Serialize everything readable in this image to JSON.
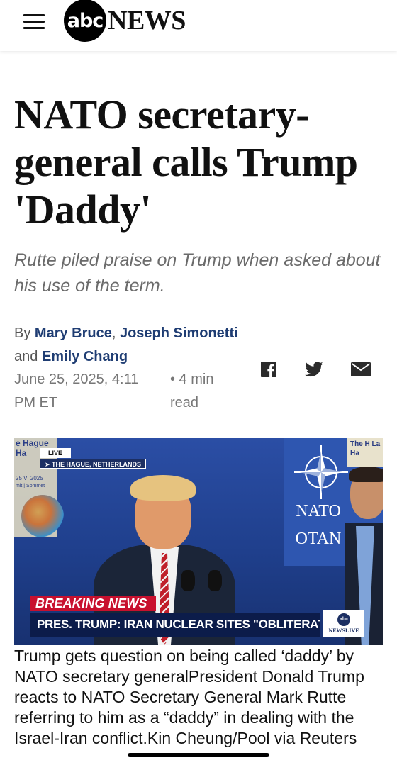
{
  "header": {
    "logo_abc": "abc",
    "logo_news": "NEWS"
  },
  "article": {
    "headline": "NATO secretary-general calls Trump 'Daddy'",
    "subhead": "Rutte piled praise on Trump when asked about his use of the term.",
    "byline": {
      "prefix": "By",
      "authors": [
        "Mary Bruce",
        "Joseph Simonetti",
        "Emily Chang"
      ],
      "sep1": ",",
      "and": "and"
    },
    "date": "June 25, 2025, 4:11 PM ET",
    "read_time": "• 4 min read"
  },
  "share": {
    "icons": [
      "facebook-icon",
      "twitter-icon",
      "email-icon"
    ]
  },
  "video": {
    "live_label": "LIVE",
    "location": "➤ THE HAGUE, NETHERLANDS",
    "bg_left_title": "e Hague Ha",
    "bg_left_date": "25 VI 2025",
    "bg_left_sub": "mit | Sommet",
    "bg_right_top": "The H La Ha",
    "nato_en": "NATO",
    "nato_fr": "OTAN",
    "breaking": "BREAKING NEWS",
    "ticker": "PRES. TRUMP: IRAN NUCLEAR SITES \"OBLITERATED\"",
    "ticker_logo_abc": "abc",
    "ticker_logo_text": "NEWSLIVE"
  },
  "caption": "Trump gets question on being called ‘daddy’ by NATO secretary generalPresident Donald Trump reacts to NATO Secretary General Mark Rutte referring to him as a “daddy” in dealing with the Israel-Iran conflict.Kin Cheung/Pool via Reuters",
  "colors": {
    "byline_link": "#1f3d73",
    "breaking_red": "#c8102e",
    "ticker_navy": "#0c1c4a"
  }
}
